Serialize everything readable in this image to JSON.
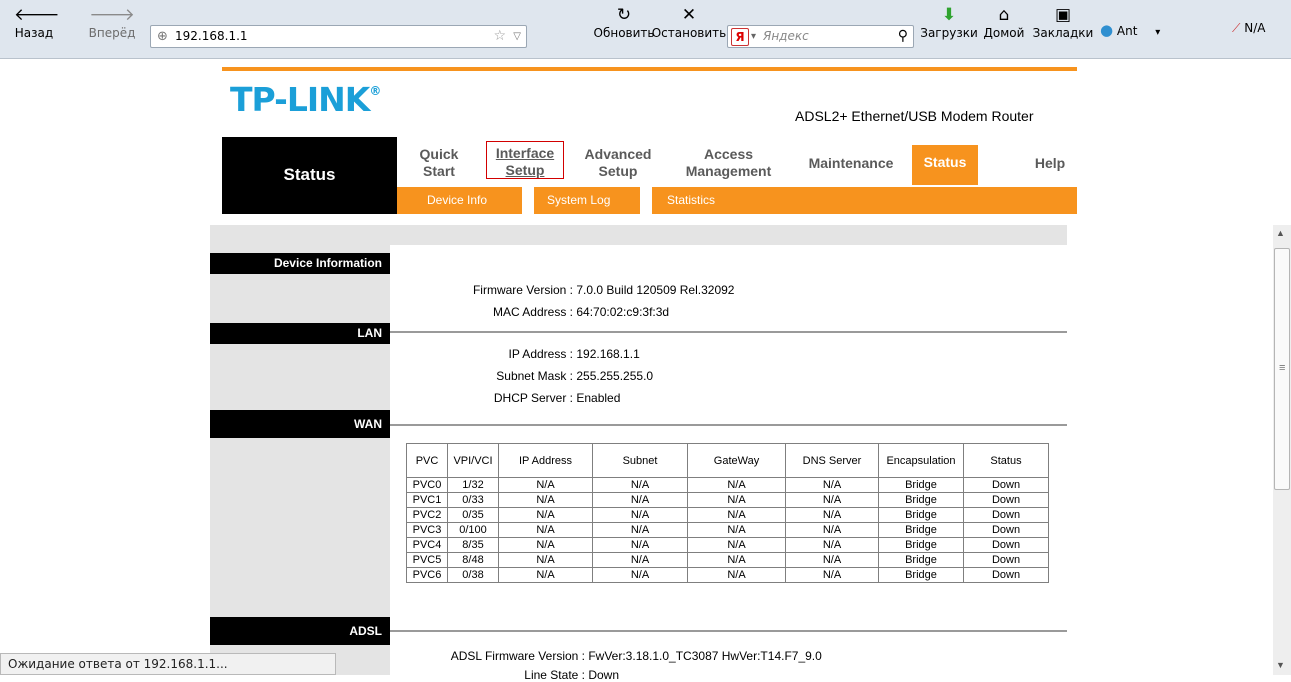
{
  "browser": {
    "back_label": "Назад",
    "forward_label": "Вперёд",
    "url": "192.168.1.1",
    "refresh_label": "Обновить",
    "stop_label": "Остановить",
    "search_placeholder": "Яндекс",
    "downloads_label": "Загрузки",
    "home_label": "Домой",
    "bookmarks_label": "Закладки",
    "profile_label": "Ant",
    "addon_label": "N/A",
    "status_text": "Ожидание ответа от 192.168.1.1..."
  },
  "router": {
    "logo_text": "TP-LINK",
    "logo_mark": "®",
    "model": "ADSL2+ Ethernet/USB Modem Router",
    "current_section": "Status",
    "nav": {
      "quick_start": [
        "Quick",
        "Start"
      ],
      "interface_setup": [
        "Interface",
        "Setup"
      ],
      "advanced_setup": [
        "Advanced",
        "Setup"
      ],
      "access_management": [
        "Access",
        "Management"
      ],
      "maintenance": "Maintenance",
      "status": "Status",
      "help": "Help"
    },
    "subnav": [
      "Device Info",
      "System Log",
      "Statistics"
    ]
  },
  "content": {
    "sections": {
      "device_info": "Device Information",
      "lan": "LAN",
      "wan": "WAN",
      "adsl": "ADSL"
    },
    "device": {
      "firmware_label": "Firmware Version :",
      "firmware_value": "7.0.0 Build 120509 Rel.32092",
      "mac_label": "MAC Address :",
      "mac_value": "64:70:02:c9:3f:3d"
    },
    "lan": {
      "ip_label": "IP Address :",
      "ip_value": "192.168.1.1",
      "mask_label": "Subnet Mask :",
      "mask_value": "255.255.255.0",
      "dhcp_label": "DHCP Server :",
      "dhcp_value": "Enabled"
    },
    "wan_table": {
      "headers": [
        "PVC",
        "VPI/VCI",
        "IP Address",
        "Subnet",
        "GateWay",
        "DNS Server",
        "Encapsulation",
        "Status"
      ],
      "rows": [
        [
          "PVC0",
          "1/32",
          "N/A",
          "N/A",
          "N/A",
          "N/A",
          "Bridge",
          "Down"
        ],
        [
          "PVC1",
          "0/33",
          "N/A",
          "N/A",
          "N/A",
          "N/A",
          "Bridge",
          "Down"
        ],
        [
          "PVC2",
          "0/35",
          "N/A",
          "N/A",
          "N/A",
          "N/A",
          "Bridge",
          "Down"
        ],
        [
          "PVC3",
          "0/100",
          "N/A",
          "N/A",
          "N/A",
          "N/A",
          "Bridge",
          "Down"
        ],
        [
          "PVC4",
          "8/35",
          "N/A",
          "N/A",
          "N/A",
          "N/A",
          "Bridge",
          "Down"
        ],
        [
          "PVC5",
          "8/48",
          "N/A",
          "N/A",
          "N/A",
          "N/A",
          "Bridge",
          "Down"
        ],
        [
          "PVC6",
          "0/38",
          "N/A",
          "N/A",
          "N/A",
          "N/A",
          "Bridge",
          "Down"
        ]
      ]
    },
    "adsl": {
      "fw_label": "ADSL Firmware Version :",
      "fw_value": "FwVer:3.18.1.0_TC3087 HwVer:T14.F7_9.0",
      "line_label": "Line State :",
      "line_value": "Down"
    }
  },
  "colors": {
    "accent_orange": "#f7931e",
    "logo_blue": "#1b9fd8",
    "highlight_red": "#d20000"
  }
}
